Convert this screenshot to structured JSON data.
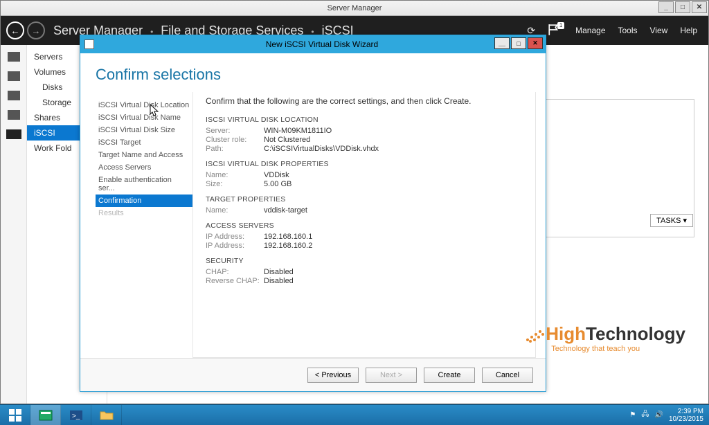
{
  "sm": {
    "title": "Server Manager",
    "breadcrumb": [
      "Server Manager",
      "File and Storage Services",
      "iSCSI"
    ],
    "menus": {
      "manage": "Manage",
      "tools": "Tools",
      "view": "View",
      "help": "Help"
    },
    "flag_badge": "1",
    "nav": {
      "servers": "Servers",
      "volumes": "Volumes",
      "disks": "Disks",
      "storage": "Storage",
      "shares": "Shares",
      "iscsi": "iSCSI",
      "workfolders": "Work Fold"
    },
    "tasks_label": "TASKS"
  },
  "wizard": {
    "title": "New iSCSI Virtual Disk Wizard",
    "heading": "Confirm selections",
    "instruction": "Confirm that the following are the correct settings, and then click Create.",
    "steps": {
      "location": "iSCSI Virtual Disk Location",
      "name": "iSCSI Virtual Disk Name",
      "size": "iSCSI Virtual Disk Size",
      "target": "iSCSI Target",
      "target_name": "Target Name and Access",
      "access": "Access Servers",
      "auth": "Enable authentication ser...",
      "confirm": "Confirmation",
      "results": "Results"
    },
    "sections": {
      "location": {
        "title": "ISCSI VIRTUAL DISK LOCATION",
        "server_k": "Server:",
        "server_v": "WIN-M09KM1811IO",
        "cluster_k": "Cluster role:",
        "cluster_v": "Not Clustered",
        "path_k": "Path:",
        "path_v": "C:\\iSCSIVirtualDisks\\VDDisk.vhdx"
      },
      "props": {
        "title": "ISCSI VIRTUAL DISK PROPERTIES",
        "name_k": "Name:",
        "name_v": "VDDisk",
        "size_k": "Size:",
        "size_v": "5.00 GB"
      },
      "target": {
        "title": "TARGET PROPERTIES",
        "name_k": "Name:",
        "name_v": "vddisk-target"
      },
      "access": {
        "title": "ACCESS SERVERS",
        "ip1_k": "IP Address:",
        "ip1_v": "192.168.160.1",
        "ip2_k": "IP Address:",
        "ip2_v": "192.168.160.2"
      },
      "security": {
        "title": "SECURITY",
        "chap_k": "CHAP:",
        "chap_v": "Disabled",
        "rchap_k": "Reverse CHAP:",
        "rchap_v": "Disabled"
      }
    },
    "buttons": {
      "prev": "< Previous",
      "next": "Next >",
      "create": "Create",
      "cancel": "Cancel"
    }
  },
  "watermark": {
    "brand1": "High",
    "brand2": "Technology",
    "tag": "Technology that teach you"
  },
  "taskbar": {
    "time": "2:39 PM",
    "date": "10/23/2015"
  }
}
